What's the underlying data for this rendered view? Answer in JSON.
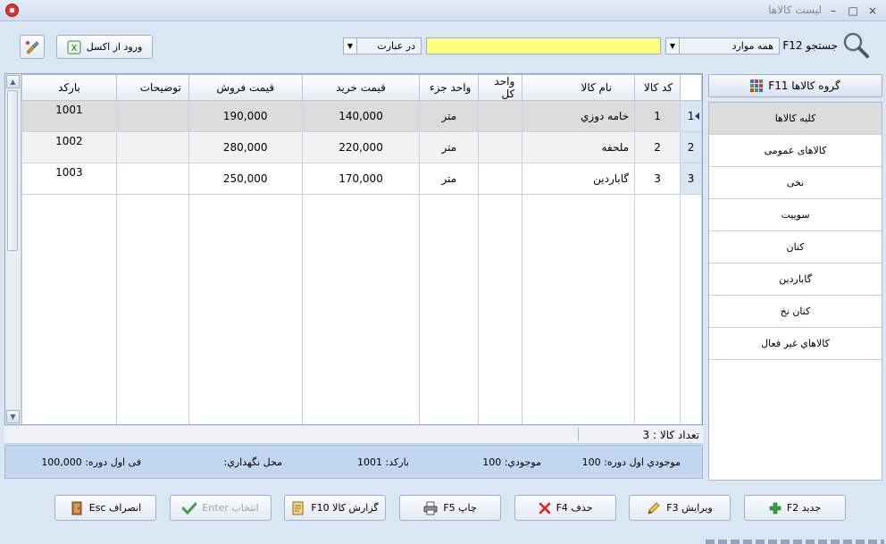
{
  "window": {
    "title": "لیست کالاها",
    "close_label": "×",
    "maximize_label": "□",
    "minimize_label": "–"
  },
  "toolbar": {
    "search_label": "جستجو F12",
    "scope_value": "همه موارد",
    "search_value": "",
    "match_value": "در عبارت",
    "import_excel_label": "ورود از اکسل"
  },
  "grid": {
    "columns": [
      "کد کالا",
      "نام کالا",
      "واحد کل",
      "واحد جزء",
      "قیمت خرید",
      "قیمت فروش",
      "توضیحات",
      "بارکد"
    ],
    "rows": [
      {
        "num": "1",
        "code": "1",
        "name": "خامه دوزي",
        "unit_total": "",
        "unit_part": "متر",
        "buy_price": "140,000",
        "sell_price": "190,000",
        "desc": "",
        "barcode": "1001"
      },
      {
        "num": "2",
        "code": "2",
        "name": "ملحفه",
        "unit_total": "",
        "unit_part": "متر",
        "buy_price": "220,000",
        "sell_price": "280,000",
        "desc": "",
        "barcode": "1002"
      },
      {
        "num": "3",
        "code": "3",
        "name": "گاباردين",
        "unit_total": "",
        "unit_part": "متر",
        "buy_price": "170,000",
        "sell_price": "250,000",
        "desc": "",
        "barcode": "1003"
      }
    ]
  },
  "count_text": "تعداد کالا : 3",
  "info": {
    "opening_stock": "موجودي اول دوره: 100",
    "stock": "موجودي: 100",
    "barcode": "بارکد: 1001",
    "location": "محل نگهداري:",
    "opening_price": "فی اول دوره: 100,000"
  },
  "groups": {
    "button_label": "گروه کالاها F11",
    "items": [
      "کلیه کالاها",
      "کالاهای عمومی",
      "نخی",
      "سوییت",
      "کتان",
      "گاباردین",
      "کتان نخ",
      "کالاهاي غير فعال"
    ]
  },
  "actions": {
    "new": "جدید F2",
    "edit": "ویرایش F3",
    "delete": "حذف F4",
    "print": "چاپ F5",
    "report": "گزارش کالا F10",
    "select": "انتخاب Enter",
    "cancel": "انصراف Esc"
  },
  "colors": {
    "accent": "#dbe6f5",
    "search_field": "#ffff80",
    "info_panel": "#c3d6f0",
    "selected_row": "#dcdcdc"
  }
}
